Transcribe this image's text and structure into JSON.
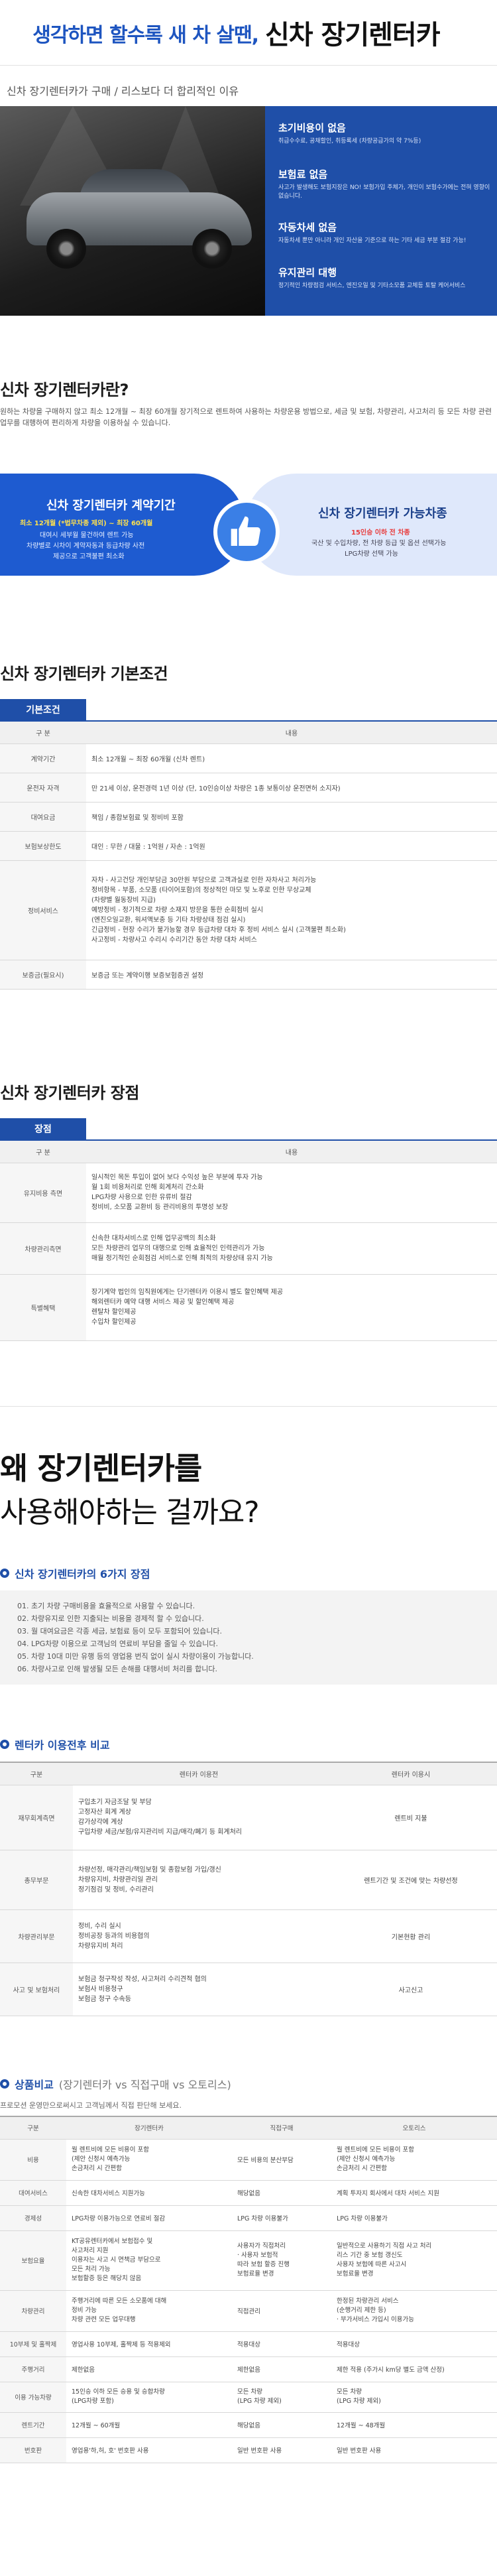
{
  "hero": {
    "left": "생각하면 할수록 새 차 살땐,",
    "right": "신차 장기렌터카"
  },
  "subtitle": "신차 장기렌터카가 구매 / 리스보다 더 합리적인 이유",
  "features": [
    {
      "title": "초기비용이 없음",
      "desc": "취급수수료, 공채할인, 취등록세 (차량공급가의 약 7%등)"
    },
    {
      "title": "보험료 없음",
      "desc": "사고가 발생해도 보험지장은 NO! 보험가입 주체가, 개인이 보험수가에는 전혀 영향이 없습니다."
    },
    {
      "title": "자동차세 없음",
      "desc": "자동차세 뿐만 아니라 개인 자산을 기준으로 하는 기타 세금 부분 절감 가능!"
    },
    {
      "title": "유지관리 대행",
      "desc": "정기적인 차량점검 서비스, 엔진오일 및 기타소모품 교체등 토탈 케어서비스"
    }
  ],
  "what": {
    "heading": "신차 장기렌터카란?",
    "para": "원하는 차량을 구매하지 않고 최소 12개월 ~ 최장 60개월 장기적으로 렌트하여 사용하는 차량운용 방법으로, 세금 및 보험, 차량관리, 사고처리 등 모든 차량 관련 업무를 대행하여 편리하게 차량을 이용하실 수 있습니다."
  },
  "pill_left": {
    "title": "신차 장기렌터카 계약기간",
    "hi": "최소 12개월 (*법무차종 제외) ~ 최장 60개월",
    "txt1": "대여시 세부월 물건하여 렌트 가능",
    "txt2": "차량별로 시차이 계약자동과 등급차량 사전",
    "txt3": "제공으로 고객불편 최소화"
  },
  "pill_right": {
    "title": "신차 장기렌터카 가능차종",
    "hi": "15인승 이하 전 차종",
    "txt1": "국산 및 수입차량, 전 차량 등급 및 옵션 선택가능",
    "txt2": "LPG차량 선택 가능"
  },
  "basic": {
    "heading": "신차 장기렌터카 기본조건",
    "tab": "기본조건",
    "col1": "구 분",
    "col2": "내용",
    "rows": [
      {
        "k": "계약기간",
        "v": [
          "최소 12개월 ~ 최장 60개월 (신차 렌트)"
        ]
      },
      {
        "k": "운전자 자격",
        "v": [
          "만 21세 이상, 운전경력 1년 이상 (단, 10인승이상 차량은 1종 보통이상 운전면허 소지자)"
        ]
      },
      {
        "k": "대여요금",
        "v": [
          "책임 / 종합보험료 및 정비비 포함"
        ]
      },
      {
        "k": "보험보상한도",
        "v": [
          "대인 : 무한 / 대물 : 1억원 / 자손 : 1억원"
        ]
      },
      {
        "k": "정비서비스",
        "v": [
          "자차 - 사고건당 개인부담금 30만원 부담으로 고객과실로 인한 자차사고 처리가능",
          "정비항목 - 부품, 소모품 (타이어포함)의 정상적인 마모 및 노후로 인한 무상교체",
          "(차량별 월동장비 지급)",
          "예방정비 - 정기적으로 차량 소재지 방문을 통한 순회점비 실시",
          "(엔진오일교환, 워셔액보충 등 기타 차량상태 점검 실시)",
          "긴급정비 - 현장 수리가 불가능할 경우 등급차량 대차 후 정비 서비스 실시 (고객불편 최소화)",
          "사고정비 - 차량사고 수리시 수리기간 동안 차량 대차 서비스"
        ]
      },
      {
        "k": "보증금(필요시)",
        "v": [
          "보증금 또는 계약이행 보증보험증권 설정"
        ]
      }
    ]
  },
  "merit": {
    "heading": "신차 장기렌터카 장점",
    "tab": "장점",
    "col1": "구 분",
    "col2": "내용",
    "rows": [
      {
        "k": "유지비용 측면",
        "v": [
          "일시적인 목돈 투입이 없어 보다 수익성 높은 부분에 투자 가능",
          "월 1회 비용처리로 인해 회계처리 간소화",
          "LPG차량 사용으로 인한 유류비 절감",
          "정비비, 소모품 교환비 등 관리비용의 투명성 보장"
        ]
      },
      {
        "k": "차량관리측면",
        "v": [
          "신속한 대차서비스로 인해 업무공백의 최소화",
          "모든 차량관리 업무의 대행으로 인해 효율적인 인력관리가 가능",
          "매월 정기적인 순회점검 서비스로 인해 최적의 차량상태 유지 가능"
        ]
      },
      {
        "k": "특별혜택",
        "v": [
          "장기계약 법인의 임직원에게는 단기렌터카 이용시 별도 할인혜택 제공",
          "해외렌터카 예약 대행 서비스 제공 및 할인혜택 제공",
          "렌탈차 할인제공",
          "수입차 할인제공"
        ]
      }
    ]
  },
  "why": {
    "line1": "왜 장기렌터카를",
    "line2": "사용해야하는 걸까요?"
  },
  "reasons": {
    "title": "신차 장기렌터카의 6가지 장점",
    "items": [
      "01. 초기 차량 구매비용을 효율적으로 사용할 수 있습니다.",
      "02. 차량유지로 인한 지출되는 비용을 경제적 할 수 있습니다.",
      "03. 월 대여요금은 각종 세금, 보험료 등이 모두 포함되어 있습니다.",
      "04. LPG차량 이용으로 고객님의 연료비 부담을 줄일 수 있습니다.",
      "05. 차량 10대 미만 유행 등의 영업용 번직 없이 실시 차량이용이 가능합니다.",
      "06. 차량사고로 인해 발생될 모든 손해를 대행서비 처리를 합니다."
    ]
  },
  "compare": {
    "title": "렌터카 이용전후 비교",
    "col1": "구분",
    "col2": "렌터카 이용전",
    "col3": "렌터카 이용시",
    "rows": [
      {
        "k": "재무회계측면",
        "a": [
          "구입초기 자금조달 및 부담",
          "고정자산 회계 계상",
          "감가상각에 계상",
          "구입차량 세금/보험/유지관리비 지급/매각/폐기 등 회계처리"
        ],
        "b": "렌트비 지불"
      },
      {
        "k": "총무부문",
        "a": [
          "차량선정, 매각관리/책임보험 및 종합보험 가입/갱신",
          "차량유지비, 차량관리일 관리",
          "정기점검 및 정비, 수리관리"
        ],
        "b": "렌트기간 및 조건에 맞는 차량선정"
      },
      {
        "k": "차량관리부문",
        "a": [
          "정비, 수리 실시",
          "정비공장 등과의 비용협의",
          "차량유지비 처리"
        ],
        "b": "기본현황 관리"
      },
      {
        "k": "사고 및 보험처리",
        "a": [
          "보험금 청구작성 작성, 사고처리 수리견적 협의",
          "보험사 비용청구",
          "보험금 청구 수속등"
        ],
        "b": "사고신고"
      }
    ]
  },
  "product": {
    "title": "상품비교",
    "title_sub": "(장기렌터카 vs 직접구매 vs 오토리스)",
    "note": "프로모션 운영만으로써시고 고객님께서 직접 판단해 보세요.",
    "cols": [
      "구분",
      "장기렌터카",
      "직접구매",
      "오토리스"
    ],
    "rows": [
      {
        "k": "비용",
        "a": [
          "월 렌트비에 모든 비용이 포함",
          "(제안 신청시 예측가능",
          "손금처리 시 간편함"
        ],
        "b": [
          "모든 비용의 분산부담"
        ],
        "c": [
          "월 렌트비에 모든 비용이 포함",
          "(제안 신청시 예측가능",
          "손금처리 시 간편함"
        ]
      },
      {
        "k": "대여서비스",
        "a": [
          "신속한 대차서비스 지원가능"
        ],
        "b": [
          "해당없음"
        ],
        "c": [
          "계획 투자지 회사에서 대차 서비스 지원"
        ]
      },
      {
        "k": "경제성",
        "a": [
          "LPG차량 이용가능으로 연료비 절감"
        ],
        "b": [
          "LPG 차량 이용불가"
        ],
        "c": [
          "LPG 차량 이용불가"
        ]
      },
      {
        "k": "보험요율",
        "a": [
          "KT공유렌터카에서 보험접수 및",
          "사고처리 지원",
          "이용자는 사고 시 면책금 부담으로",
          "모든 처리 가능",
          "보험할증 등은 해당치 않음"
        ],
        "b": [
          "사용자가 직접처리",
          "· 사용자 보험적",
          "따라 보험 할증 진행",
          "보험료율 변경"
        ],
        "c": [
          "일반적으로 사용하기 직접 사고 처리",
          "리스 기간 중 보험 갱신도",
          "사용자 보험에 따른 사고시",
          "보험료율 변경"
        ]
      },
      {
        "k": "차량관리",
        "a": [
          "주행거리에 따른 모든 소모품에 대해",
          "정비 가능",
          "차량 관련 모든 업무대행"
        ],
        "b": [
          "직접관리"
        ],
        "c": [
          "한정된 차량관리 서비스",
          "(순행거리 제한 등)",
          "· 부가서비스 가입시 이용가능"
        ]
      },
      {
        "k": "10부제 및 홀짝제",
        "a": [
          "영업사용 10부제, 홀짝제 등 적용제외"
        ],
        "b": [
          "적용대상"
        ],
        "c": [
          "적용대상"
        ]
      },
      {
        "k": "주행거리",
        "a": [
          "제한없음"
        ],
        "b": [
          "제한없음"
        ],
        "c": [
          "제한 적용 (주가시 km당 별도 금액 산정)"
        ]
      },
      {
        "k": "이용 가능차량",
        "a": [
          "15인승 이하 모든 승용 및 승합차량",
          "(LPG차량 포함)"
        ],
        "b": [
          "모든 차량",
          "(LPG 차량 제외)"
        ],
        "c": [
          "모든 차량",
          "(LPG 차량 제외)"
        ]
      },
      {
        "k": "렌트기간",
        "a": [
          "12개월 ~ 60개월"
        ],
        "b": [
          "해당없음"
        ],
        "c": [
          "12개월 ~ 48개월"
        ]
      },
      {
        "k": "번호판",
        "a": [
          "영업용'하,허, 호' 번호판 사용"
        ],
        "b": [
          "일반 번호판 사용"
        ],
        "c": [
          "일반 번호판 사용"
        ]
      }
    ]
  }
}
